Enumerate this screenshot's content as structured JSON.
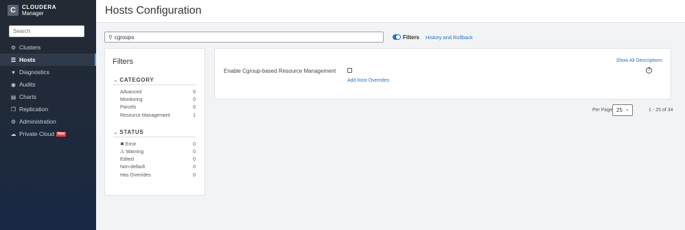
{
  "brand": {
    "line1": "CLOUDERA",
    "line2": "Manager",
    "logo_letter": "C"
  },
  "sidebar": {
    "search_placeholder": "Search",
    "items": [
      {
        "label": "Clusters",
        "icon": "clusters-icon"
      },
      {
        "label": "Hosts",
        "icon": "list-icon",
        "active": true
      },
      {
        "label": "Diagnostics",
        "icon": "heartbeat-icon"
      },
      {
        "label": "Audits",
        "icon": "binoculars-icon"
      },
      {
        "label": "Charts",
        "icon": "bar-chart-icon"
      },
      {
        "label": "Replication",
        "icon": "copy-icon"
      },
      {
        "label": "Administration",
        "icon": "gear-icon"
      },
      {
        "label": "Private Cloud",
        "icon": "cloud-icon",
        "badge": "New"
      }
    ]
  },
  "header": {
    "title": "Hosts Configuration"
  },
  "toolbar": {
    "search_value": "cgroups",
    "filters_label": "Filters",
    "filters_toggle_on": true,
    "history_link": "History and Rollback"
  },
  "filters": {
    "title": "Filters",
    "category": {
      "heading": "CATEGORY",
      "rows": [
        {
          "label": "Advanced",
          "count": "0"
        },
        {
          "label": "Monitoring",
          "count": "0"
        },
        {
          "label": "Parcels",
          "count": "0"
        },
        {
          "label": "Resource Management",
          "count": "1"
        }
      ]
    },
    "status": {
      "heading": "STATUS",
      "rows": [
        {
          "label": "Error",
          "count": "0",
          "icon": "error-icon"
        },
        {
          "label": "Warning",
          "count": "0",
          "icon": "warning-icon"
        },
        {
          "label": "Edited",
          "count": "0"
        },
        {
          "label": "Non-default",
          "count": "0"
        },
        {
          "label": "Has Overrides",
          "count": "0"
        }
      ]
    }
  },
  "content": {
    "show_all_descriptions": "Show All Descriptions",
    "property": {
      "label": "Enable Cgroup-based Resource Management",
      "checked": false,
      "override_link": "Add Host Overrides"
    }
  },
  "pagination": {
    "per_page_label": "Per Page",
    "per_page_value": "25",
    "range": "1 - 25 of 34"
  },
  "colors": {
    "accent": "#1f6fd1",
    "sidebar": "#1f2a3a",
    "badge": "#e2473b"
  }
}
